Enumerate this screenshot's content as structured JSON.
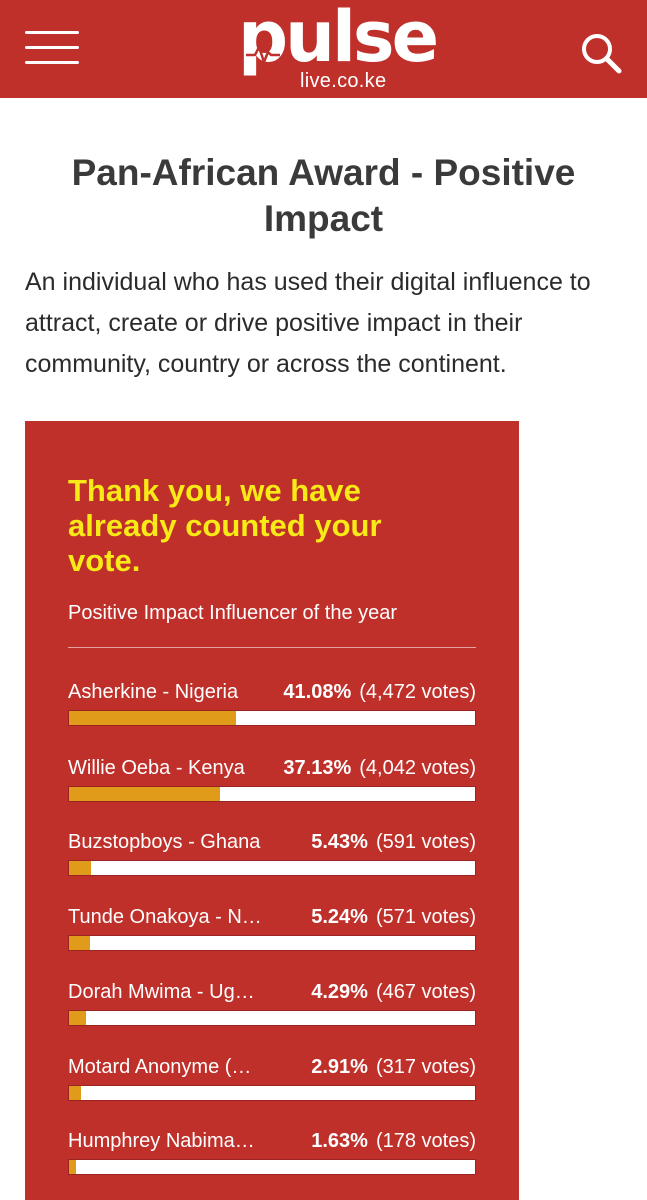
{
  "header": {
    "logo_text": "pulse",
    "logo_sub": "live.co.ke",
    "menu_icon": "hamburger-menu-icon",
    "search_icon": "search-icon",
    "brand_color": "#c0302b"
  },
  "article": {
    "title": "Pan-African Award - Positive Impact",
    "description": "An individual who has used their digital influence to attract, create or drive positive impact in their community, country or across the continent."
  },
  "poll": {
    "thanks_message": "Thank you, we have already counted your vote.",
    "question": "Positive Impact Influencer of the year",
    "accent_color": "#f7ea16",
    "bar_color": "#e09b1a",
    "options": [
      {
        "name": "Asherkine - Nigeria",
        "percent": "41.08%",
        "votes": "(4,472 votes)",
        "fraction": 0.4108
      },
      {
        "name": "Willie Oeba - Kenya",
        "percent": "37.13%",
        "votes": "(4,042 votes)",
        "fraction": 0.3713
      },
      {
        "name": "Buzstopboys - Ghana",
        "percent": "5.43%",
        "votes": "(591 votes)",
        "fraction": 0.0543
      },
      {
        "name": "Tunde Onakoya - Nigeria",
        "percent": "5.24%",
        "votes": "(571 votes)",
        "fraction": 0.0524
      },
      {
        "name": "Dorah Mwima - Uganda",
        "percent": "4.29%",
        "votes": "(467 votes)",
        "fraction": 0.0429
      },
      {
        "name": "Motard Anonyme (@...",
        "percent": "2.91%",
        "votes": "(317 votes)",
        "fraction": 0.0291
      },
      {
        "name": "Humphrey Nabimanya...",
        "percent": "1.63%",
        "votes": "(178 votes)",
        "fraction": 0.0163
      }
    ]
  }
}
